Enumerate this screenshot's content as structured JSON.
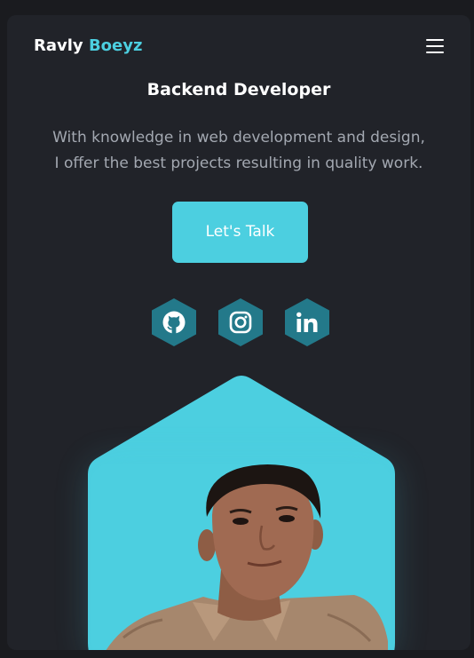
{
  "header": {
    "logo_first": "Ravly",
    "logo_second": "Boeyz",
    "menu_icon": "hamburger-menu-icon"
  },
  "hero": {
    "role": "Backend Developer",
    "description_line1": "With knowledge in web development and design,",
    "description_line2": "I offer the best projects resulting in quality work.",
    "cta_label": "Let's Talk"
  },
  "social": {
    "icons": [
      "github-icon",
      "instagram-icon",
      "linkedin-icon"
    ]
  },
  "colors": {
    "accent": "#4ccfe0",
    "social_bg": "#23798a",
    "background": "#212329",
    "text_muted": "#a3a8b1"
  }
}
